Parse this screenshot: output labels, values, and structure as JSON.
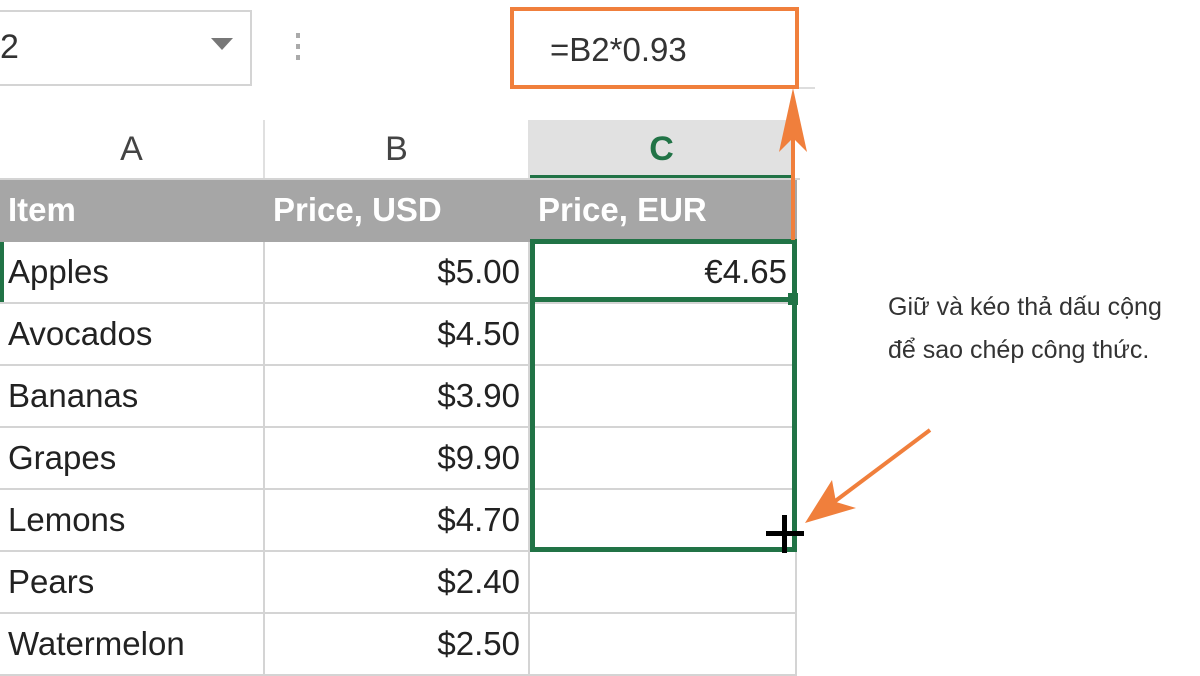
{
  "name_box": {
    "value": "2"
  },
  "formula_bar": {
    "value": "=B2*0.93"
  },
  "columns": [
    "A",
    "B",
    "C"
  ],
  "selected_column": "C",
  "header_row": [
    "Item",
    "Price, USD",
    "Price, EUR"
  ],
  "rows": [
    [
      "Apples",
      "$5.00",
      "€4.65"
    ],
    [
      "Avocados",
      "$4.50",
      ""
    ],
    [
      "Bananas",
      "$3.90",
      ""
    ],
    [
      "Grapes",
      "$9.90",
      ""
    ],
    [
      "Lemons",
      "$4.70",
      ""
    ],
    [
      "Pears",
      "$2.40",
      ""
    ],
    [
      "Watermelon",
      "$2.50",
      ""
    ]
  ],
  "annotation": "Giữ và kéo thả dấu cộng để sao chép công thức.",
  "colors": {
    "accent": "#217346",
    "highlight": "#f07f3c",
    "header_bg": "#a6a6a6"
  }
}
